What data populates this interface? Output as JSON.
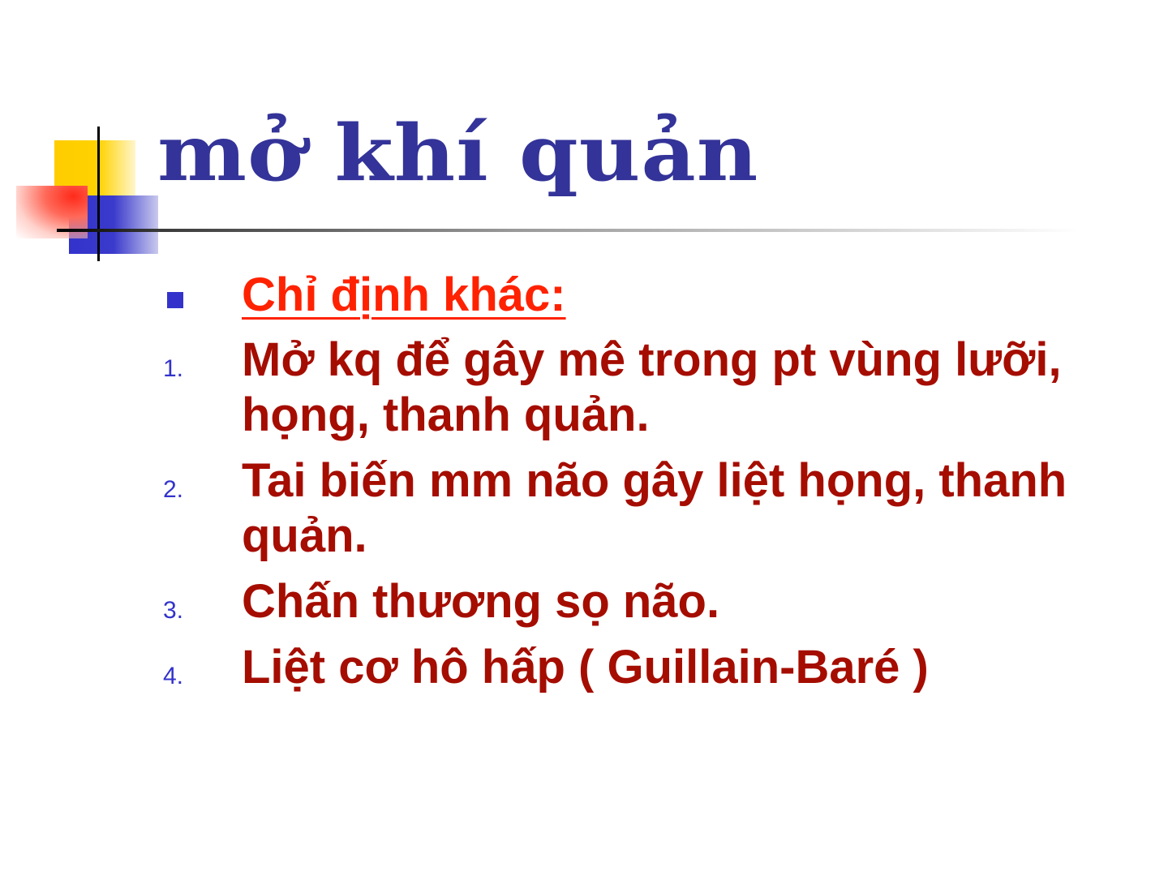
{
  "slide": {
    "title": "mở khí quản",
    "heading": "Chỉ định khác:",
    "items": [
      {
        "number": "1.",
        "text": "Mở kq để gây mê trong pt vùng lưỡi, họng, thanh quản."
      },
      {
        "number": "2.",
        "text": "Tai biến mm não gây liệt họng, thanh quản."
      },
      {
        "number": "3.",
        "text": "Chấn thương sọ não."
      },
      {
        "number": "4.",
        "text": "Liệt cơ hô hấp ( Guillain-Baré )"
      }
    ]
  },
  "colors": {
    "title": "#333399",
    "heading": "#ff2200",
    "body_text": "#a50d00",
    "bullet": "#3333cc"
  }
}
